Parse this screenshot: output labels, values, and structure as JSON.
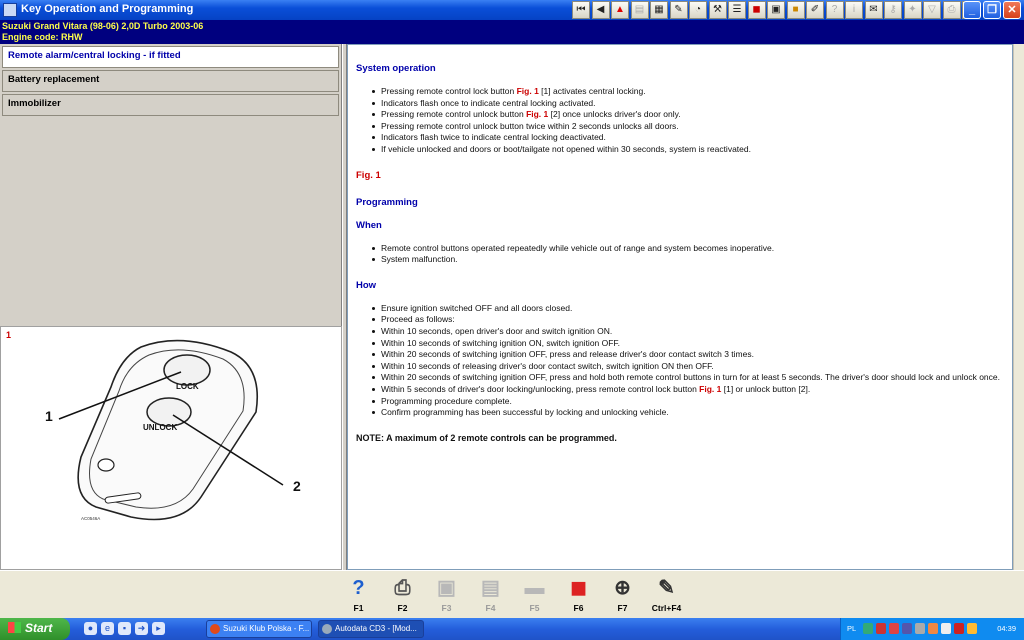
{
  "window": {
    "title": "Key Operation and Programming",
    "toolbar_icons": [
      "first-page-icon",
      "back-icon",
      "warning-icon",
      "doc-icon",
      "chart-icon",
      "wrench-icon",
      "gauge-icon",
      "tools-icon",
      "list-icon",
      "car-icon",
      "book-icon",
      "folder-icon",
      "pen-icon",
      "help-icon",
      "info-icon",
      "note-icon",
      "key-icon",
      "pin-icon",
      "filter-icon",
      "print-icon",
      "more-icon"
    ],
    "controls": [
      "minimize",
      "maximize",
      "close"
    ]
  },
  "vehicle": {
    "line1": "Suzuki   Grand Vitara (98-06) 2,0D Turbo 2003-06",
    "line2": "Engine code: RHW"
  },
  "nav": {
    "items": [
      {
        "label": "Remote alarm/central locking - if fitted",
        "active": true
      },
      {
        "label": "Battery replacement",
        "active": false
      },
      {
        "label": "Immobilizer",
        "active": false
      }
    ]
  },
  "figure": {
    "number": "1",
    "button_lock": "LOCK",
    "button_unlock": "UNLOCK",
    "callout_1": "1",
    "callout_2": "2",
    "code": "AC0546A"
  },
  "content": {
    "system_operation_heading": "System operation",
    "system_operation": {
      "item1_pre": "Pressing remote control lock button ",
      "item1_fig": "Fig. 1",
      "item1_post": " [1] activates central locking.",
      "item2": "Indicators flash once to indicate central locking activated.",
      "item3_pre": "Pressing remote control unlock button ",
      "item3_fig": "Fig. 1",
      "item3_post": " [2] once unlocks driver's door only.",
      "item4": "Pressing remote control unlock button twice within 2 seconds unlocks all doors.",
      "item5": "Indicators flash twice to indicate central locking deactivated.",
      "item6": "If vehicle unlocked and doors or boot/tailgate not opened within 30 seconds, system is reactivated."
    },
    "fig_label": "Fig. 1",
    "programming_heading": "Programming",
    "when_heading": "When",
    "when": [
      "Remote control buttons operated repeatedly while vehicle out of range and system becomes inoperative.",
      "System malfunction."
    ],
    "how_heading": "How",
    "how": {
      "item1": "Ensure ignition switched OFF and all doors closed.",
      "item2": "Proceed as follows:",
      "item3": "Within 10 seconds, open driver's door and switch ignition ON.",
      "item4": "Within 10 seconds of switching ignition ON, switch ignition OFF.",
      "item5": "Within 20 seconds of switching ignition OFF, press and release driver's door contact switch 3 times.",
      "item6": "Within 10 seconds of releasing driver's door contact switch, switch ignition ON then OFF.",
      "item7": "Within 20 seconds of switching ignition OFF, press and hold both remote control buttons in turn for at least 5 seconds. The driver's door should lock and unlock once.",
      "item8_pre": "Within 5 seconds of driver's door locking/unlocking, press remote control lock button ",
      "item8_fig": "Fig. 1",
      "item8_post": " [1] or unlock button [2].",
      "item9": "Programming procedure complete.",
      "item10": "Confirm programming has been successful by locking and unlocking vehicle."
    },
    "note": "NOTE: A maximum of 2 remote controls can be programmed."
  },
  "fkeys": [
    {
      "label": "F1",
      "icon": "help-icon",
      "enabled": true
    },
    {
      "label": "F2",
      "icon": "print-icon",
      "enabled": true
    },
    {
      "label": "F3",
      "icon": "image-icon",
      "enabled": false
    },
    {
      "label": "F4",
      "icon": "images-icon",
      "enabled": false
    },
    {
      "label": "F5",
      "icon": "car-icon",
      "enabled": false
    },
    {
      "label": "F6",
      "icon": "vehicle-select-icon",
      "enabled": true
    },
    {
      "label": "F7",
      "icon": "crosshair-icon",
      "enabled": true
    },
    {
      "label": "Ctrl+F4",
      "icon": "notes-icon",
      "enabled": true
    }
  ],
  "taskbar": {
    "start": "Start",
    "tasks": [
      {
        "label": "Suzuki Klub Polska - F...",
        "active": false
      },
      {
        "label": "Autodata CD3 - [Mod...",
        "active": true
      }
    ],
    "lang": "PL",
    "clock": "04:39"
  }
}
